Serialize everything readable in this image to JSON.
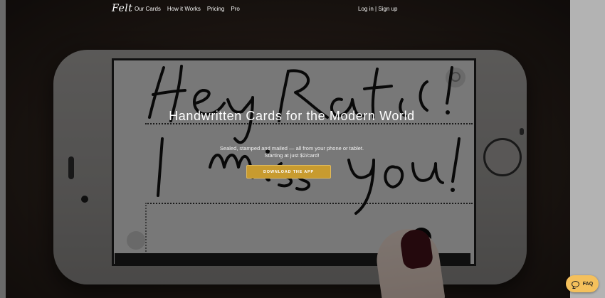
{
  "nav": {
    "logo": "Felt",
    "links": [
      "Our Cards",
      "How it Works",
      "Pricing",
      "Pro"
    ],
    "login": "Log in",
    "separator": "|",
    "signup": "Sign up"
  },
  "hero": {
    "headline": "Handwritten Cards for the Modern World",
    "subtext_line1": "Sealed, stamped and mailed — all from your phone or tablet.",
    "subtext_line2": "Starting at just $2/card!",
    "cta_label": "DOWNLOAD THE APP"
  },
  "faq": {
    "label": "FAQ",
    "icon": "chat-bubble-icon"
  },
  "colors": {
    "accent": "#c89b2f",
    "faq_background": "#f4c05c",
    "text": "#ffffff"
  }
}
